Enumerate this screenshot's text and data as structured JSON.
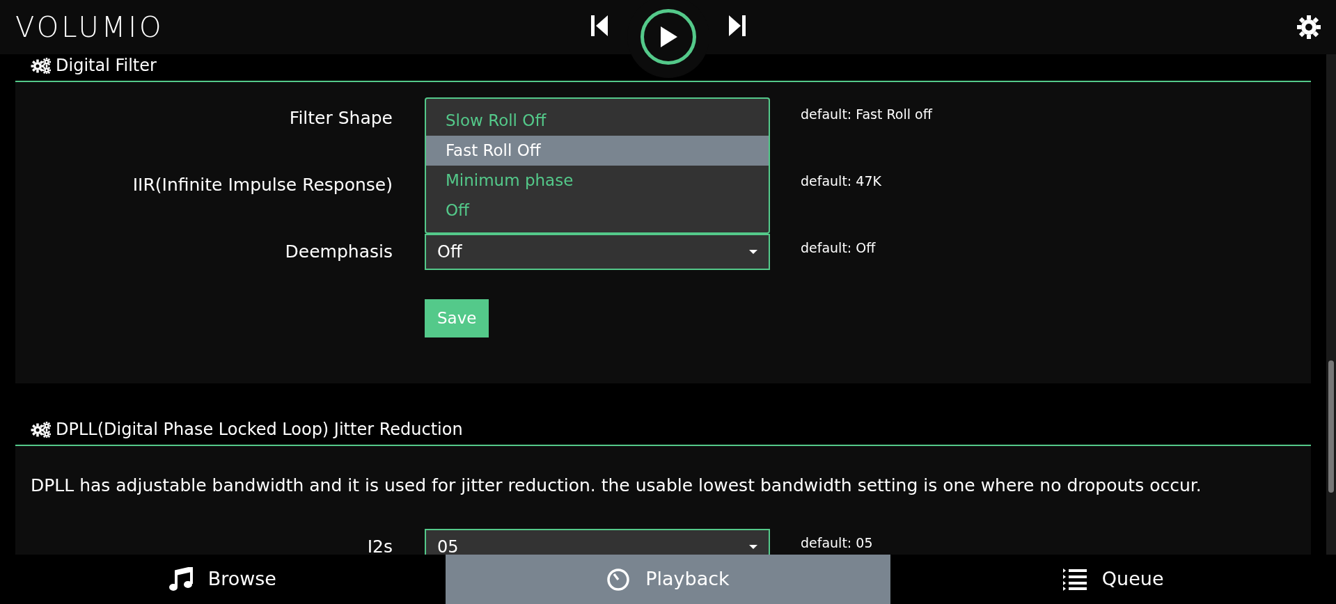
{
  "header": {
    "logo": "VOLUMIO"
  },
  "sections": [
    {
      "title": "Digital Filter",
      "rows": [
        {
          "label": "Filter Shape",
          "default": "default: Fast Roll off",
          "expanded": true,
          "options": [
            {
              "label": "Slow Roll Off",
              "selected": false
            },
            {
              "label": "Fast Roll Off",
              "selected": true
            },
            {
              "label": "Minimum phase",
              "selected": false
            },
            {
              "label": "Off",
              "selected": false
            }
          ]
        },
        {
          "label": "IIR(Infinite Impulse Response)",
          "default": "default: 47K",
          "expanded": false
        },
        {
          "label": "Deemphasis",
          "default": "default: Off",
          "expanded": false,
          "value": "Off"
        }
      ],
      "button": "Save"
    },
    {
      "title": "DPLL(Digital Phase Locked Loop) Jitter Reduction",
      "description": "DPLL has adjustable bandwidth and it is used for jitter reduction. the usable lowest bandwidth setting is one where no dropouts occur.",
      "rows": [
        {
          "label": "I2s",
          "default": "default: 05",
          "expanded": false,
          "value": "05"
        }
      ]
    }
  ],
  "nav": [
    {
      "label": "Browse",
      "kind": "music",
      "selected": false
    },
    {
      "label": "Playback",
      "kind": "dial",
      "selected": true
    },
    {
      "label": "Queue",
      "kind": "list",
      "selected": false
    }
  ]
}
